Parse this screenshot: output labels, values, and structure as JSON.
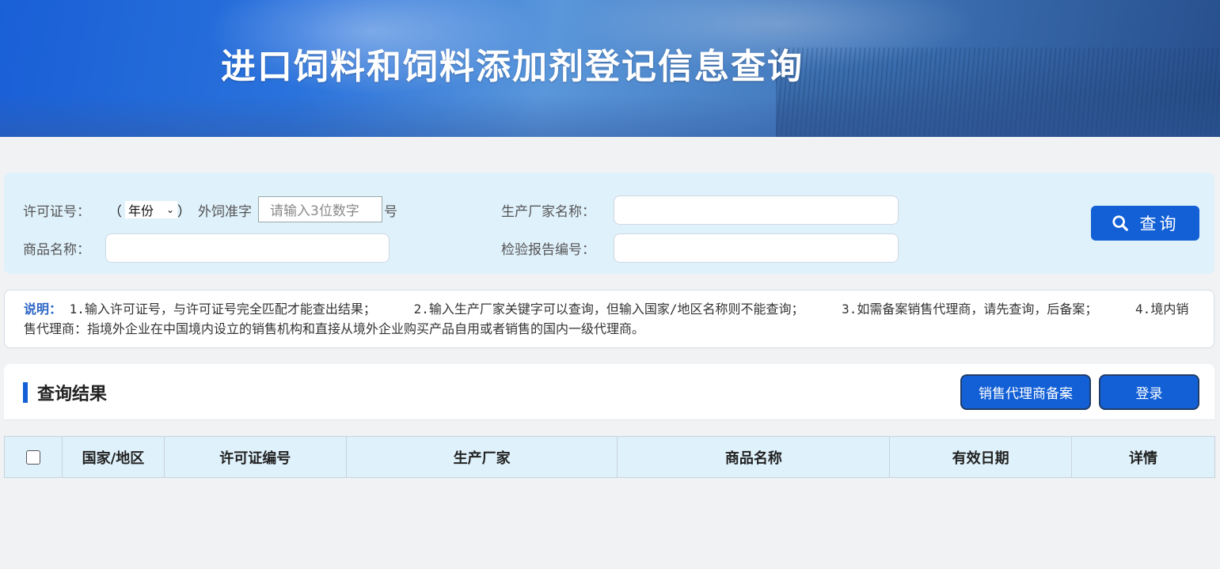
{
  "banner": {
    "title": "进口饲料和饲料添加剂登记信息查询"
  },
  "search": {
    "license_label": "许可证号：",
    "year_open": "（",
    "year_value": "年份",
    "year_close": "）",
    "prefix": "外饲准字",
    "number_placeholder": "请输入3位数字",
    "suffix": "号",
    "manufacturer_label": "生产厂家名称：",
    "product_label": "商品名称：",
    "report_label": "检验报告编号：",
    "manufacturer_value": "",
    "product_value": "",
    "report_value": "",
    "query_button": "查询"
  },
  "notes": {
    "tag": "说明：",
    "item1": "1.输入许可证号，与许可证号完全匹配才能查出结果；",
    "item2": "2.输入生产厂家关键字可以查询，但输入国家/地区名称则不能查询；",
    "item3": "3.如需备案销售代理商，请先查询，后备案；",
    "item4": "4.境内销售代理商：指境外企业在中国境内设立的销售机构和直接从境外企业购买产品自用或者销售的国内一级代理商。"
  },
  "results": {
    "title": "查询结果",
    "agent_button": "销售代理商备案",
    "login_button": "登录",
    "columns": [
      "国家/地区",
      "许可证编号",
      "生产厂家",
      "商品名称",
      "有效日期",
      "详情"
    ]
  },
  "colors": {
    "primary": "#1360d6",
    "panel": "#dff1fb",
    "page": "#f0f2f4"
  }
}
